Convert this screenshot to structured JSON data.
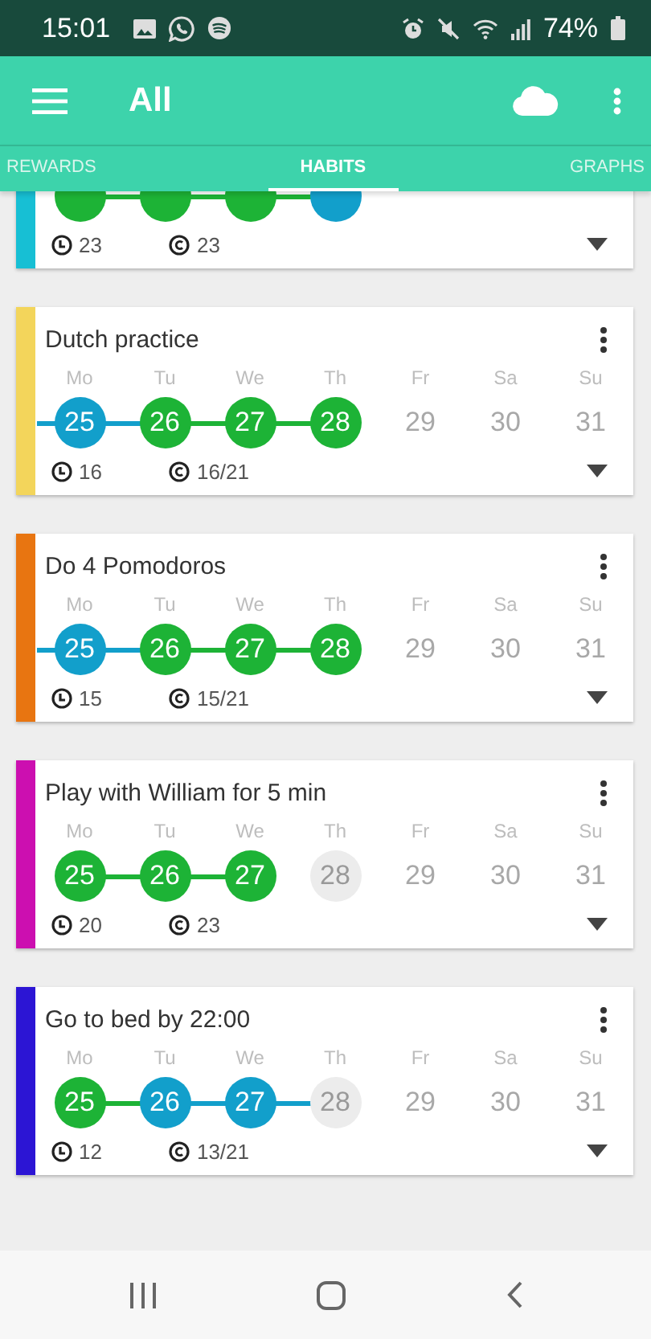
{
  "status_bar": {
    "time": "15:01",
    "battery": "74%"
  },
  "app_bar": {
    "title": "All"
  },
  "tabs": [
    {
      "label": "REWARDS",
      "selected": false
    },
    {
      "label": "HABITS",
      "selected": true
    },
    {
      "label": "GRAPHS",
      "selected": false
    }
  ],
  "habits": [
    {
      "color": "#17bfd4",
      "days": [
        {
          "kind": "done",
          "linked": false
        },
        {
          "kind": "done",
          "linked": true
        },
        {
          "kind": "done",
          "linked": true
        },
        {
          "kind": "partial",
          "linked": true
        }
      ],
      "streak": "23",
      "count": "23"
    },
    {
      "title": "Dutch practice",
      "color": "#f3d55b",
      "days": [
        {
          "weekday": "Mo",
          "date": "25",
          "kind": "partial",
          "linked": true
        },
        {
          "weekday": "Tu",
          "date": "26",
          "kind": "done",
          "linked": true
        },
        {
          "weekday": "We",
          "date": "27",
          "kind": "done",
          "linked": true
        },
        {
          "weekday": "Th",
          "date": "28",
          "kind": "done",
          "linked": true
        },
        {
          "weekday": "Fr",
          "date": "29",
          "kind": "future",
          "linked": false
        },
        {
          "weekday": "Sa",
          "date": "30",
          "kind": "future",
          "linked": false
        },
        {
          "weekday": "Su",
          "date": "31",
          "kind": "future",
          "linked": false
        }
      ],
      "streak": "16",
      "count": "16/21"
    },
    {
      "title": "Do 4 Pomodoros",
      "color": "#e87511",
      "days": [
        {
          "weekday": "Mo",
          "date": "25",
          "kind": "partial",
          "linked": true
        },
        {
          "weekday": "Tu",
          "date": "26",
          "kind": "done",
          "linked": true
        },
        {
          "weekday": "We",
          "date": "27",
          "kind": "done",
          "linked": true
        },
        {
          "weekday": "Th",
          "date": "28",
          "kind": "done",
          "linked": true
        },
        {
          "weekday": "Fr",
          "date": "29",
          "kind": "future",
          "linked": false
        },
        {
          "weekday": "Sa",
          "date": "30",
          "kind": "future",
          "linked": false
        },
        {
          "weekday": "Su",
          "date": "31",
          "kind": "future",
          "linked": false
        }
      ],
      "streak": "15",
      "count": "15/21"
    },
    {
      "title": "Play with William for 5 min",
      "color": "#cc0fb0",
      "days": [
        {
          "weekday": "Mo",
          "date": "25",
          "kind": "done",
          "linked": false
        },
        {
          "weekday": "Tu",
          "date": "26",
          "kind": "done",
          "linked": true
        },
        {
          "weekday": "We",
          "date": "27",
          "kind": "done",
          "linked": true
        },
        {
          "weekday": "Th",
          "date": "28",
          "kind": "today",
          "linked": false
        },
        {
          "weekday": "Fr",
          "date": "29",
          "kind": "future",
          "linked": false
        },
        {
          "weekday": "Sa",
          "date": "30",
          "kind": "future",
          "linked": false
        },
        {
          "weekday": "Su",
          "date": "31",
          "kind": "future",
          "linked": false
        }
      ],
      "streak": "20",
      "count": "23"
    },
    {
      "title": "Go to bed by 22:00",
      "color": "#2c15d4",
      "days": [
        {
          "weekday": "Mo",
          "date": "25",
          "kind": "done",
          "linked": false
        },
        {
          "weekday": "Tu",
          "date": "26",
          "kind": "partial",
          "linked": true
        },
        {
          "weekday": "We",
          "date": "27",
          "kind": "partial",
          "linked": true
        },
        {
          "weekday": "Th",
          "date": "28",
          "kind": "today",
          "linked": true
        },
        {
          "weekday": "Fr",
          "date": "29",
          "kind": "future",
          "linked": false
        },
        {
          "weekday": "Sa",
          "date": "30",
          "kind": "future",
          "linked": false
        },
        {
          "weekday": "Su",
          "date": "31",
          "kind": "future",
          "linked": false
        }
      ],
      "streak": "12",
      "count": "13/21"
    }
  ]
}
